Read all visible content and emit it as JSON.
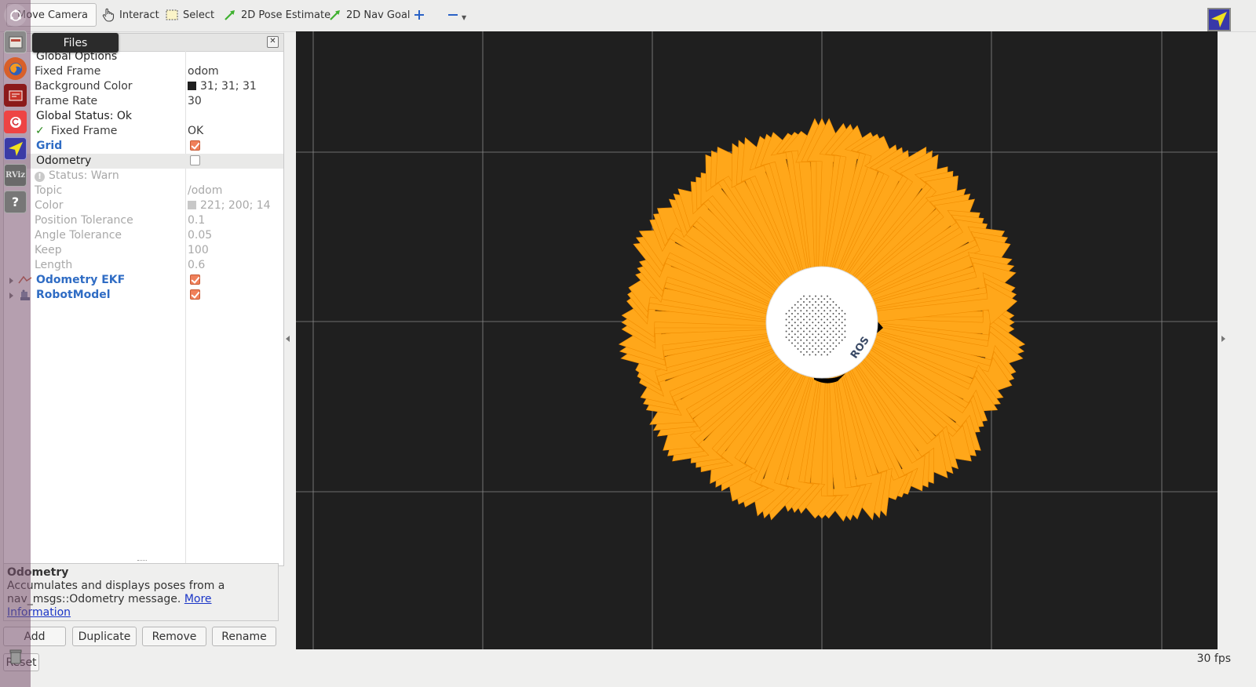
{
  "toolbar": {
    "tools": [
      "Move Camera",
      "Interact",
      "Select",
      "2D Pose Estimate",
      "2D Nav Goal"
    ]
  },
  "displays": {
    "rows": [
      {
        "label": "Global Options",
        "value": ""
      },
      {
        "label": "Fixed Frame",
        "value": "odom"
      },
      {
        "label": "Background Color",
        "value": "31; 31; 31"
      },
      {
        "label": "Frame Rate",
        "value": "30"
      },
      {
        "label": "Global Status: Ok",
        "value": ""
      },
      {
        "label": "Fixed Frame",
        "value": "OK"
      },
      {
        "label": "Grid",
        "value": ""
      },
      {
        "label": "Odometry",
        "value": ""
      },
      {
        "label": "Status: Warn",
        "value": ""
      },
      {
        "label": "Topic",
        "value": "/odom"
      },
      {
        "label": "Color",
        "value": "221; 200; 14"
      },
      {
        "label": "Position Tolerance",
        "value": "0.1"
      },
      {
        "label": "Angle Tolerance",
        "value": "0.05"
      },
      {
        "label": "Keep",
        "value": "100"
      },
      {
        "label": "Length",
        "value": "0.6"
      },
      {
        "label": "Odometry EKF",
        "value": ""
      },
      {
        "label": "RobotModel",
        "value": ""
      }
    ],
    "checked": {
      "grid": true,
      "odometry": false,
      "odometry_ekf": true,
      "robot_model": true
    },
    "bg_color": "#1f1f1f",
    "odom_color": "#ddc80e"
  },
  "description": {
    "title": "Odometry",
    "text": "Accumulates and displays poses from a nav_msgs::Odometry message.",
    "link": "More Information"
  },
  "buttons": {
    "add": "Add",
    "duplicate": "Duplicate",
    "remove": "Remove",
    "rename": "Rename",
    "reset": "Reset"
  },
  "status": {
    "fps": "30 fps"
  },
  "launcher": {
    "tooltip": "Files",
    "rviz_label": "RViz"
  },
  "robot": {
    "logo_text": "ROS"
  },
  "colors": {
    "arrow": "#ffa71a",
    "arrow_edge": "#f08c00",
    "accent_blue": "#2f6cc4"
  }
}
